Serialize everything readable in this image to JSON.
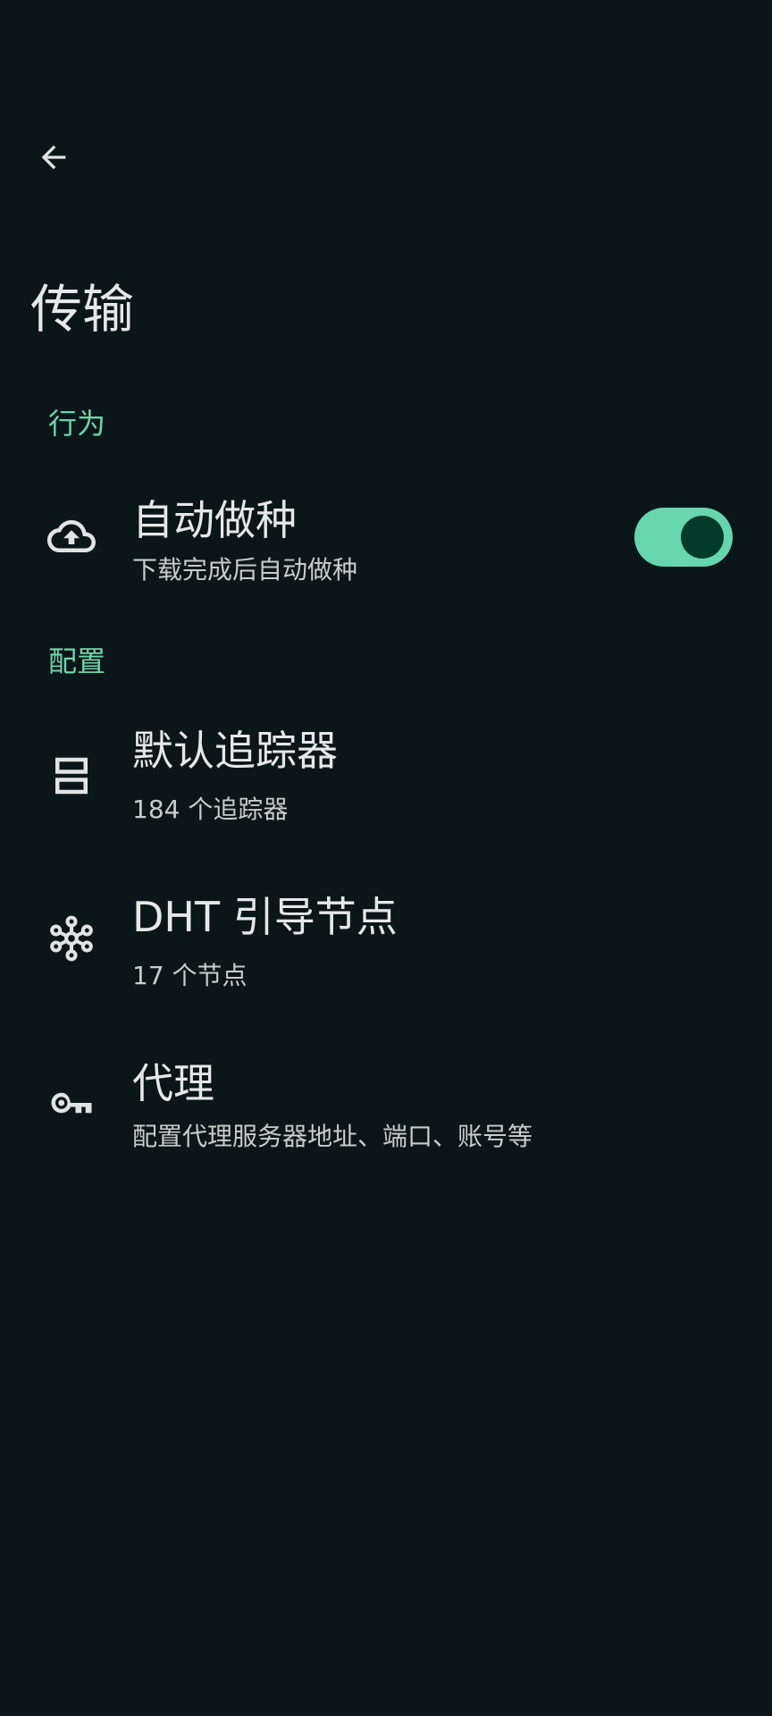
{
  "header": {
    "title": "传输"
  },
  "sections": [
    {
      "header": "行为",
      "items": [
        {
          "title": "自动做种",
          "subtitle": "下载完成后自动做种",
          "icon": "cloud-upload-icon",
          "toggle": true
        }
      ]
    },
    {
      "header": "配置",
      "items": [
        {
          "title": "默认追踪器",
          "subtitle": "184 个追踪器",
          "icon": "server-icon"
        },
        {
          "title": "DHT 引导节点",
          "subtitle": "17 个节点",
          "icon": "network-nodes-icon"
        },
        {
          "title": "代理",
          "subtitle": "配置代理服务器地址、端口、账号等",
          "icon": "key-icon"
        }
      ]
    }
  ],
  "colors": {
    "background": "#0b1619",
    "accent": "#6ed5a9",
    "switch_track": "#65d6ae",
    "switch_thumb": "#033b2a"
  }
}
